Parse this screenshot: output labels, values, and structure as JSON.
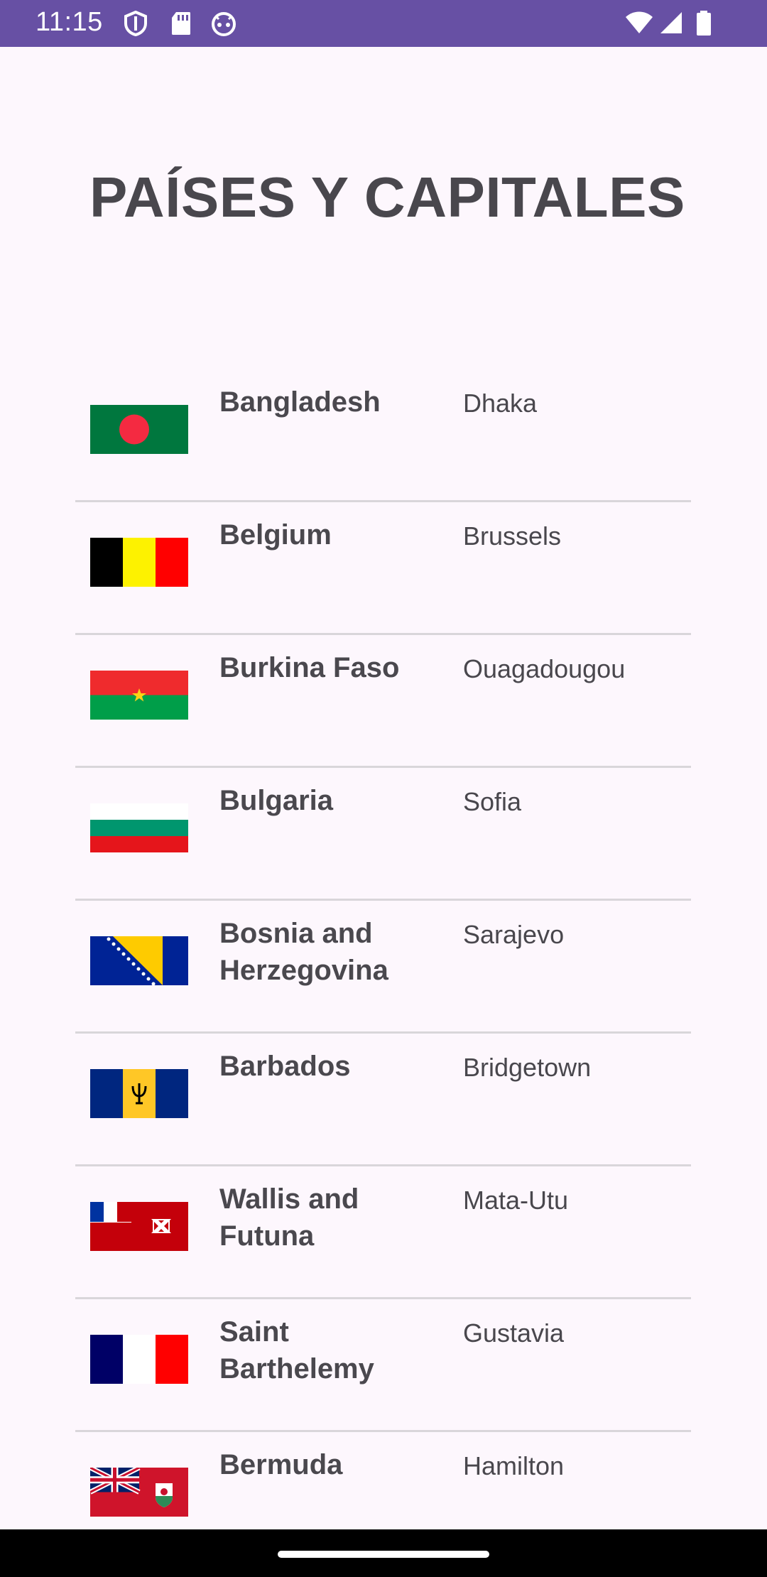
{
  "status_bar": {
    "time": "11:15",
    "icons": [
      "shield-icon",
      "sd-card-icon",
      "android-face-icon",
      "wifi-icon",
      "signal-icon",
      "battery-icon"
    ],
    "background": "#6750a4"
  },
  "title": "PAÍSES Y CAPITALES",
  "countries": [
    {
      "name": "Bangladesh",
      "capital": "Dhaka",
      "flag": "bangladesh-flag-icon"
    },
    {
      "name": "Belgium",
      "capital": "Brussels",
      "flag": "belgium-flag-icon"
    },
    {
      "name": "Burkina Faso",
      "capital": "Ouagadougou",
      "flag": "burkina-faso-flag-icon"
    },
    {
      "name": "Bulgaria",
      "capital": "Sofia",
      "flag": "bulgaria-flag-icon"
    },
    {
      "name": "Bosnia and Herzegovina",
      "capital": "Sarajevo",
      "flag": "bosnia-flag-icon"
    },
    {
      "name": "Barbados",
      "capital": "Bridgetown",
      "flag": "barbados-flag-icon"
    },
    {
      "name": "Wallis and Futuna",
      "capital": "Mata-Utu",
      "flag": "wallis-futuna-flag-icon"
    },
    {
      "name": "Saint Barthelemy",
      "capital": "Gustavia",
      "flag": "saint-barthelemy-flag-icon"
    },
    {
      "name": "Bermuda",
      "capital": "Hamilton",
      "flag": "bermuda-flag-icon"
    }
  ],
  "colors": {
    "background": "#fdf7fd",
    "divider": "#d9d6da",
    "text": "#4a484e"
  }
}
